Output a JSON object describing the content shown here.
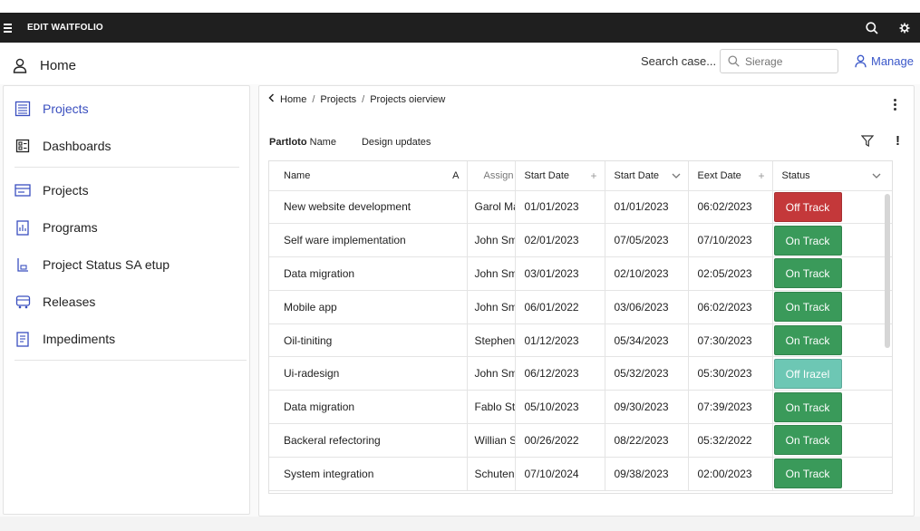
{
  "titlebar": {
    "title": "EDIT WAITFOLIO",
    "icons": [
      "menu-icon",
      "search-icon",
      "gear-icon"
    ]
  },
  "header": {
    "home_label": "Home",
    "search_label": "Search case...",
    "search_placeholder": "Sierage",
    "manage_label": "Manage"
  },
  "sidebar": {
    "items": [
      {
        "label": "Projects",
        "icon": "list-icon",
        "active": true
      },
      {
        "label": "Dashboards",
        "icon": "dashboard-icon"
      },
      {
        "label": "Projects",
        "icon": "folder-icon"
      },
      {
        "label": "Programs",
        "icon": "programs-icon"
      },
      {
        "label": "Project Status SA etup",
        "icon": "status-icon"
      },
      {
        "label": "Releases",
        "icon": "releases-icon"
      },
      {
        "label": "Impediments",
        "icon": "impediments-icon"
      }
    ]
  },
  "main": {
    "breadcrumb": [
      "Home",
      "Projects",
      "Projects oierview"
    ],
    "tab_bold": "Partloto",
    "tab_name": "Name",
    "tab_design": "Design updates"
  },
  "table": {
    "columns": [
      "Name",
      "A",
      "Assign",
      "Start Date",
      "Start Date",
      "Eext Date",
      "Status"
    ],
    "rows": [
      {
        "name": "New website development",
        "assign": "Garol Ma",
        "start1": "01/01/2023",
        "start2": "01/01/2023",
        "end": "06:02/2023",
        "status": "Off Track",
        "color": "red"
      },
      {
        "name": "Self ware implementation",
        "assign": "John Sm",
        "start1": "02/01/2023",
        "start2": "07/05/2023",
        "end": "07/10/2023",
        "status": "On Track",
        "color": "green"
      },
      {
        "name": "Data migration",
        "assign": "John Sm",
        "start1": "03/01/2023",
        "start2": "02/10/2023",
        "end": "02:05/2023",
        "status": "On Track",
        "color": "green"
      },
      {
        "name": "Mobile app",
        "assign": "John Sm",
        "start1": "06/01/2022",
        "start2": "03/06/2023",
        "end": "06:02/2023",
        "status": "On Track",
        "color": "green"
      },
      {
        "name": "Oil-tiniting",
        "assign": "Stephen",
        "start1": "01/12/2023",
        "start2": "05/34/2023",
        "end": "07:30/2023",
        "status": "On Track",
        "color": "green"
      },
      {
        "name": "Ui-radesign",
        "assign": "John Sm",
        "start1": "06/12/2023",
        "start2": "05/32/2023",
        "end": "05:30/2023",
        "status": "Off Irazel",
        "color": "teal"
      },
      {
        "name": "Data migration",
        "assign": "Fablo St",
        "start1": "05/10/2023",
        "start2": "09/30/2023",
        "end": "07:39/2023",
        "status": "On Track",
        "color": "green"
      },
      {
        "name": "Backeral refectoring",
        "assign": "Willian S",
        "start1": "00/26/2022",
        "start2": "08/22/2023",
        "end": "05:32/2022",
        "status": "On Track",
        "color": "green"
      },
      {
        "name": "System integration",
        "assign": "Schuten",
        "start1": "07/10/2024",
        "start2": "09/38/2023",
        "end": "02:00/2023",
        "status": "On Track",
        "color": "green"
      }
    ]
  },
  "colors": {
    "accent": "#3a57c9",
    "off_track": "#c4383a",
    "on_track": "#3a9a5a",
    "off_teal": "#6dc7b4",
    "titlebar": "#1f1f1f"
  }
}
